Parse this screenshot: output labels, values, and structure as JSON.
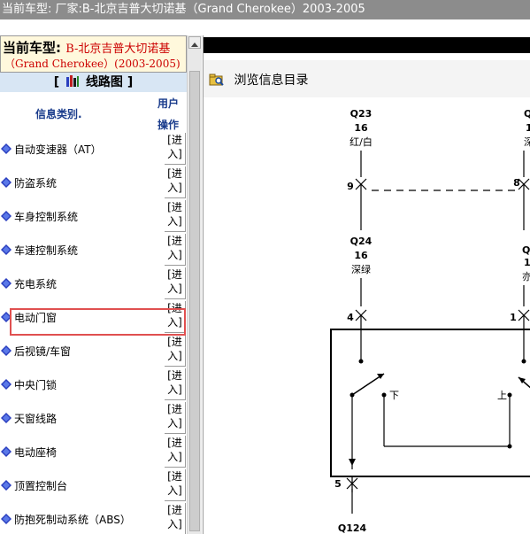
{
  "window": {
    "title": "当前车型:  厂家:B-北京吉普大切诺基（Grand Cherokee）2003-2005"
  },
  "vehicle": {
    "label": "当前车型:",
    "name": "B-北京吉普大切诺基",
    "years": "（Grand Cherokee）(2003-2005)"
  },
  "section": {
    "bracket_open": "[",
    "title": "线路图",
    "bracket_close": "]"
  },
  "columns": {
    "category": "信息类别.",
    "user": "用户",
    "action": "操作"
  },
  "categories": [
    {
      "label": "自动变速器（AT）",
      "action": "[进入]"
    },
    {
      "label": "防盗系统",
      "action": "[进入]"
    },
    {
      "label": "车身控制系统",
      "action": "[进入]"
    },
    {
      "label": "车速控制系统",
      "action": "[进入]"
    },
    {
      "label": "充电系统",
      "action": "[进入]"
    },
    {
      "label": "电动门窗",
      "action": "[进入]"
    },
    {
      "label": "后视镜/车窗",
      "action": "[进入]"
    },
    {
      "label": "中央门锁",
      "action": "[进入]"
    },
    {
      "label": "天窗线路",
      "action": "[进入]"
    },
    {
      "label": "电动座椅",
      "action": "[进入]"
    },
    {
      "label": "顶置控制台",
      "action": "[进入]"
    },
    {
      "label": "防抱死制动系统（ABS）",
      "action": "[进入]"
    }
  ],
  "selected_category": "电动门窗",
  "toolbar": {
    "browse_label": "浏览信息目录"
  },
  "diagram": {
    "wire_top_left_id": "Q23",
    "wire_top_left_gauge": "16",
    "wire_top_left_color": "红/白",
    "wire_top_right_id": "Q",
    "wire_top_right_gauge": "1",
    "wire_top_right_color": "深",
    "pin_9": "9",
    "pin_8": "8",
    "wire_mid_left_id": "Q24",
    "wire_mid_left_gauge": "16",
    "wire_mid_left_color": "深绿",
    "wire_mid_right_id": "Q",
    "wire_mid_right_gauge": "1",
    "wire_mid_right_color": "亦",
    "pin_4": "4",
    "pin_1": "1",
    "switch_down": "下",
    "switch_up": "上",
    "pin_5": "5",
    "wire_bottom_id": "Q124"
  },
  "colors": {
    "titlebar_bg": "#8c8c8c",
    "model_box_bg": "#fff8dc",
    "accent_red": "#cc0000",
    "section_bg": "#d8e6f4",
    "header_text": "#1a3c8c",
    "highlight_border": "#e05050",
    "list_icon": "#2a3fbf"
  }
}
